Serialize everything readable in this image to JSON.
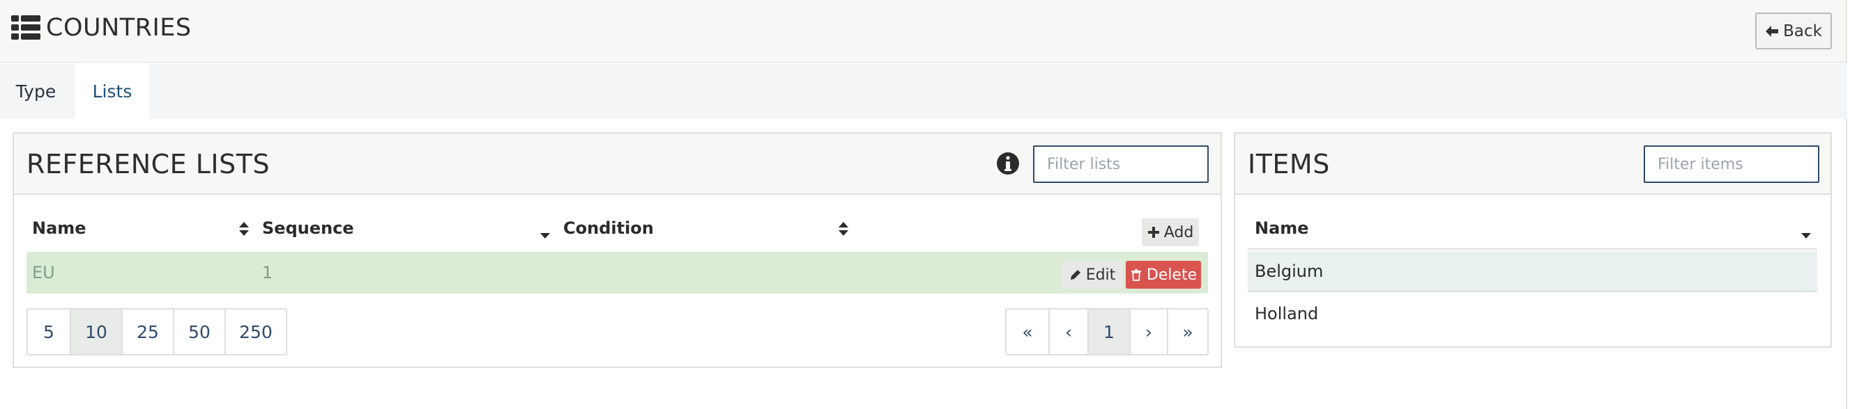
{
  "header": {
    "title": "COUNTRIES",
    "back_label": "Back"
  },
  "tabs": [
    {
      "label": "Type"
    },
    {
      "label": "Lists"
    }
  ],
  "reference_lists": {
    "title": "REFERENCE LISTS",
    "filter_placeholder": "Filter lists",
    "columns": {
      "name": "Name",
      "sequence": "Sequence",
      "condition": "Condition"
    },
    "add_label": "Add",
    "rows": [
      {
        "name": "EU",
        "sequence": "1",
        "edit_label": "Edit",
        "delete_label": "Delete"
      }
    ],
    "page_sizes": [
      "5",
      "10",
      "25",
      "50",
      "250"
    ],
    "active_page_size": "10",
    "pager": [
      "«",
      "‹",
      "1",
      "›",
      "»"
    ],
    "current_page": "1"
  },
  "items": {
    "title": "ITEMS",
    "filter_placeholder": "Filter items",
    "column": "Name",
    "rows": [
      "Belgium",
      "Holland"
    ]
  },
  "colors": {
    "accent": "#2f4a6a",
    "danger": "#d9534f",
    "selected_row": "#dcebd5"
  }
}
